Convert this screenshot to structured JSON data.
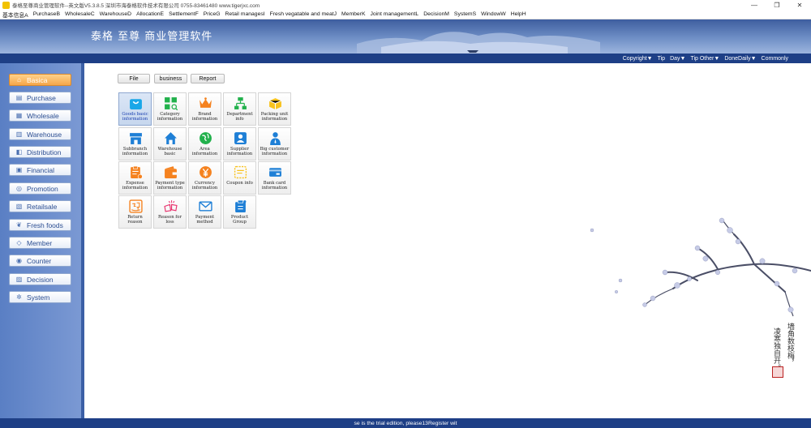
{
  "window": {
    "title": "泰格至尊商业管理软件--英文版V5.3.8.5   深圳市海泰格软件技术有限公司   0755-83461480   www.tigerjxc.com",
    "controls": [
      "—",
      "❐",
      "✕"
    ]
  },
  "menubar": {
    "items": [
      "基本信息A",
      "PurchaseB",
      "WholesaleC",
      "WarehouseD",
      "AllocationE",
      "SettlementF",
      "PriceG",
      "Retail managesI",
      "Fresh vegatable and meatJ",
      "MemberK",
      "Joint managementL",
      "DecisionM",
      "SystemS",
      "WindowW",
      "HelpH"
    ]
  },
  "banner": {
    "brand": "泰格 至尊 商业管理软件"
  },
  "topbar": {
    "links": [
      "Copyright▼",
      "Tip",
      "Day▼",
      "Tip Other▼",
      "DoneDaily▼",
      "Commonly"
    ]
  },
  "sidebar": {
    "items": [
      {
        "label": "Basica",
        "icon": "home-icon",
        "glyph": "⌂",
        "active": true
      },
      {
        "label": "Purchase",
        "icon": "cart-icon",
        "glyph": "▤"
      },
      {
        "label": "Wholesale",
        "icon": "box-icon",
        "glyph": "▦"
      },
      {
        "label": "Warehouse",
        "icon": "warehouse-icon",
        "glyph": "▥"
      },
      {
        "label": "Distribution",
        "icon": "truck-icon",
        "glyph": "◧"
      },
      {
        "label": "Financial",
        "icon": "ledger-icon",
        "glyph": "▣"
      },
      {
        "label": "Promotion",
        "icon": "tag-icon",
        "glyph": "◎"
      },
      {
        "label": "Retailsale",
        "icon": "register-icon",
        "glyph": "▧"
      },
      {
        "label": "Fresh foods",
        "icon": "leaf-icon",
        "glyph": "❦"
      },
      {
        "label": "Member",
        "icon": "member-icon",
        "glyph": "◇"
      },
      {
        "label": "Counter",
        "icon": "counter-icon",
        "glyph": "◉"
      },
      {
        "label": "Decision",
        "icon": "chart-icon",
        "glyph": "▨"
      },
      {
        "label": "System",
        "icon": "gear-icon",
        "glyph": "✲"
      }
    ]
  },
  "tabs": [
    "File",
    "business",
    "Report"
  ],
  "tiles": [
    {
      "label": "Goods basic information",
      "icon": "shopping-bag-icon",
      "color": "#1aa7e8",
      "selected": true
    },
    {
      "label": "Category information",
      "icon": "category-grid-icon",
      "color": "#22b14c"
    },
    {
      "label": "Brand information",
      "icon": "crown-icon",
      "color": "#f5821f"
    },
    {
      "label": "Department info",
      "icon": "org-chart-icon",
      "color": "#22b14c"
    },
    {
      "label": "Packing unit information",
      "icon": "package-icon",
      "color": "#f7c21e"
    },
    {
      "label": "Subbranch information",
      "icon": "store-icon",
      "color": "#1e7fd6"
    },
    {
      "label": "Warehouse basic",
      "icon": "warehouse-house-icon",
      "color": "#1e7fd6"
    },
    {
      "label": "Area information",
      "icon": "globe-icon",
      "color": "#22b14c"
    },
    {
      "label": "Supplier information",
      "icon": "supplier-contact-icon",
      "color": "#1e7fd6"
    },
    {
      "label": "Big customer information",
      "icon": "customer-icon",
      "color": "#1e7fd6"
    },
    {
      "label": "Expense information",
      "icon": "expense-clipboard-icon",
      "color": "#f5821f"
    },
    {
      "label": "Payment type information",
      "icon": "wallet-icon",
      "color": "#f5821f"
    },
    {
      "label": "Currency information",
      "icon": "yen-coin-icon",
      "color": "#f5821f"
    },
    {
      "label": "Coupon info",
      "icon": "coupon-icon",
      "color": "#f7c21e"
    },
    {
      "label": "Bank card information",
      "icon": "bank-card-icon",
      "color": "#1e7fd6"
    },
    {
      "label": "Return reason",
      "icon": "return-icon",
      "color": "#f5821f"
    },
    {
      "label": "Reason for loss",
      "icon": "loss-icon",
      "color": "#e8336e"
    },
    {
      "label": "Payment method",
      "icon": "envelope-icon",
      "color": "#1e7fd6"
    },
    {
      "label": "Product Group",
      "icon": "product-group-icon",
      "color": "#1e7fd6"
    }
  ],
  "status": {
    "text": "se is the trial edition, please13Register wit"
  },
  "poem": {
    "line1": "墙角数枝梅，",
    "line2": "凌寒独自开。"
  },
  "theme": {
    "accent": "#1e3f86",
    "active_nav": "#f5a64a"
  }
}
